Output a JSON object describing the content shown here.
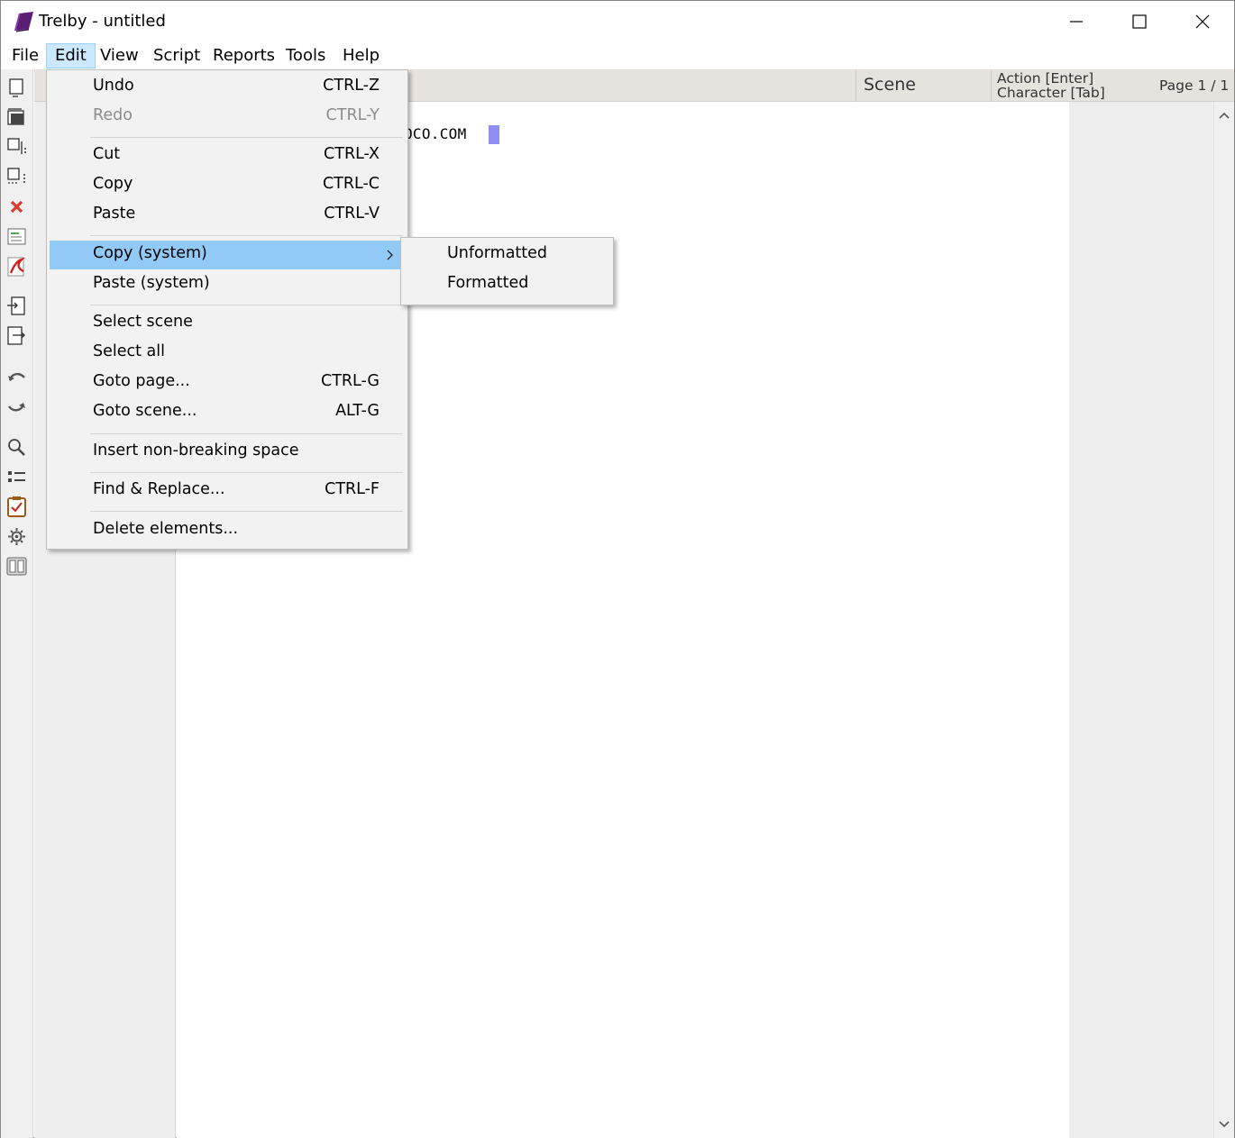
{
  "window": {
    "title": "Trelby - untitled",
    "icons": {
      "app": "trelby-book-icon",
      "minimize": "minimize-icon",
      "maximize": "maximize-icon",
      "close": "close-icon"
    }
  },
  "menubar": {
    "items": [
      {
        "label": "File"
      },
      {
        "label": "Edit",
        "active": true
      },
      {
        "label": "View"
      },
      {
        "label": "Script"
      },
      {
        "label": "Reports"
      },
      {
        "label": "Tools"
      },
      {
        "label": "Help"
      }
    ]
  },
  "toolbar": {
    "icons": [
      "new-icon",
      "open-icon",
      "save-icon",
      "save-as-icon",
      "close-script-icon",
      "script-settings-icon",
      "pdf-icon",
      "import-icon",
      "export-icon",
      "undo-icon",
      "redo-icon",
      "find-icon",
      "navigator-icon",
      "checks-icon",
      "settings-icon",
      "compare-icon"
    ]
  },
  "header": {
    "scene": "Scene",
    "type_line1": "Action [Enter]",
    "type_line2": "Character [Tab]",
    "page": "Page 1 / 1"
  },
  "editor": {
    "text": "OCO.COM"
  },
  "edit_menu": {
    "undo": {
      "label": "Undo",
      "shortcut": "CTRL-Z"
    },
    "redo": {
      "label": "Redo",
      "shortcut": "CTRL-Y",
      "disabled": true
    },
    "cut": {
      "label": "Cut",
      "shortcut": "CTRL-X"
    },
    "copy": {
      "label": "Copy",
      "shortcut": "CTRL-C"
    },
    "paste": {
      "label": "Paste",
      "shortcut": "CTRL-V"
    },
    "copy_system": {
      "label": "Copy (system)",
      "highlighted": true,
      "has_submenu": true
    },
    "paste_system": {
      "label": "Paste (system)"
    },
    "select_scene": {
      "label": "Select scene"
    },
    "select_all": {
      "label": "Select all"
    },
    "goto_page": {
      "label": "Goto page...",
      "shortcut": "CTRL-G"
    },
    "goto_scene": {
      "label": "Goto scene...",
      "shortcut": "ALT-G"
    },
    "insert_nbsp": {
      "label": "Insert non-breaking space"
    },
    "find_replace": {
      "label": "Find & Replace...",
      "shortcut": "CTRL-F"
    },
    "delete_elements": {
      "label": "Delete elements..."
    }
  },
  "copy_system_submenu": {
    "unformatted": "Unformatted",
    "formatted": "Formatted"
  },
  "colors": {
    "menu_highlight": "#91c9f7",
    "menubar_active": "#cce8ff",
    "cursor": "#8e8ef0",
    "header_bg": "#e6e3df"
  }
}
